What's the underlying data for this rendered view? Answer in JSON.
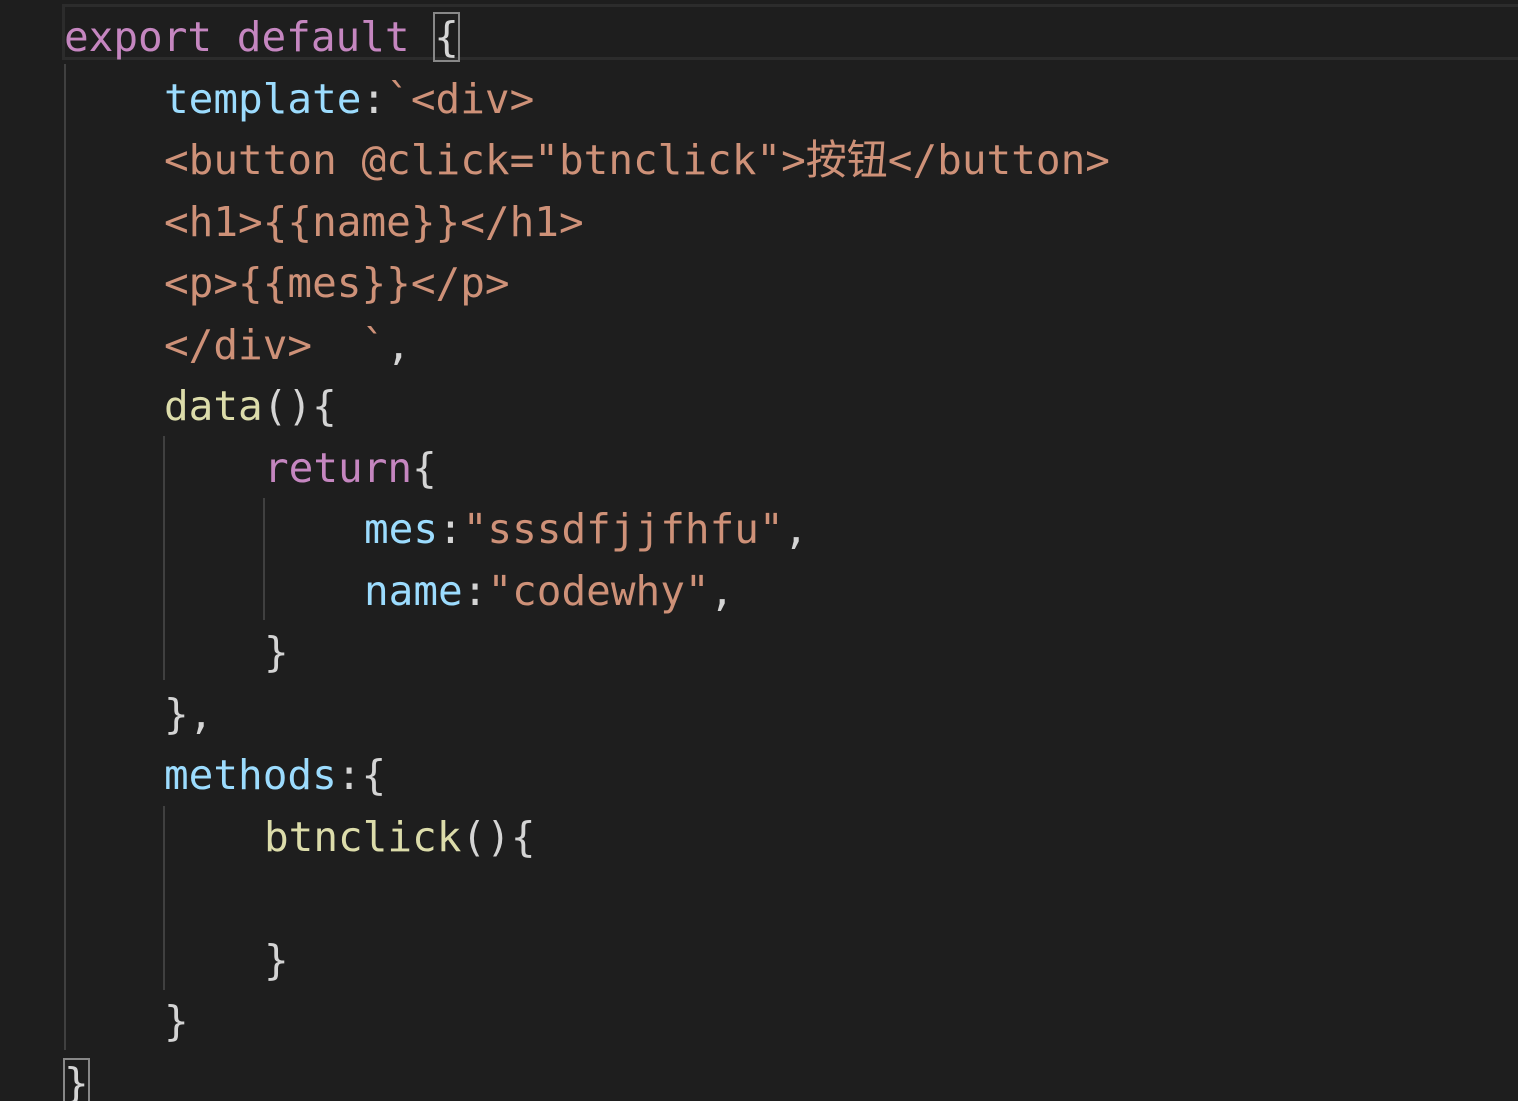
{
  "editor": {
    "colors": {
      "background": "#1e1e1e",
      "keyword": "#c586c0",
      "property": "#9cdcfe",
      "string": "#ce9178",
      "function": "#dcdcaa",
      "punctuation": "#d4d4d4",
      "bracket_highlight": "#888888"
    },
    "lines": [
      {
        "name": "line-export",
        "indent": 0,
        "tokens": [
          {
            "t": "export default ",
            "c": "keyword"
          },
          {
            "t": "{",
            "c": "punctuation",
            "highlight": true
          }
        ]
      },
      {
        "name": "line-template",
        "indent": 1,
        "tokens": [
          {
            "t": "template",
            "c": "property"
          },
          {
            "t": ":",
            "c": "punctuation"
          },
          {
            "t": "`<div>",
            "c": "string"
          }
        ]
      },
      {
        "name": "line-button",
        "indent": 1,
        "tokens": [
          {
            "t": "<button @click=\"btnclick\">按钮</button>",
            "c": "string"
          }
        ]
      },
      {
        "name": "line-h1",
        "indent": 1,
        "tokens": [
          {
            "t": "<h1>{{name}}</h1>",
            "c": "string"
          }
        ]
      },
      {
        "name": "line-p",
        "indent": 1,
        "tokens": [
          {
            "t": "<p>{{mes}}</p>",
            "c": "string"
          }
        ]
      },
      {
        "name": "line-div-close",
        "indent": 1,
        "tokens": [
          {
            "t": "</div>  `",
            "c": "string"
          },
          {
            "t": ",",
            "c": "punctuation"
          }
        ]
      },
      {
        "name": "line-data",
        "indent": 1,
        "tokens": [
          {
            "t": "data",
            "c": "function"
          },
          {
            "t": "(){",
            "c": "punctuation"
          }
        ]
      },
      {
        "name": "line-return",
        "indent": 2,
        "tokens": [
          {
            "t": "return",
            "c": "keyword"
          },
          {
            "t": "{",
            "c": "punctuation"
          }
        ]
      },
      {
        "name": "line-mes",
        "indent": 3,
        "tokens": [
          {
            "t": "mes",
            "c": "property"
          },
          {
            "t": ":",
            "c": "punctuation"
          },
          {
            "t": "\"sssdfjjfhfu\"",
            "c": "string"
          },
          {
            "t": ",",
            "c": "punctuation"
          }
        ]
      },
      {
        "name": "line-name",
        "indent": 3,
        "tokens": [
          {
            "t": "name",
            "c": "property"
          },
          {
            "t": ":",
            "c": "punctuation"
          },
          {
            "t": "\"codewhy\"",
            "c": "string"
          },
          {
            "t": ",",
            "c": "punctuation"
          }
        ]
      },
      {
        "name": "line-return-close",
        "indent": 2,
        "tokens": [
          {
            "t": "}",
            "c": "punctuation"
          }
        ]
      },
      {
        "name": "line-data-close",
        "indent": 1,
        "tokens": [
          {
            "t": "},",
            "c": "punctuation"
          }
        ]
      },
      {
        "name": "line-methods",
        "indent": 1,
        "tokens": [
          {
            "t": "methods",
            "c": "property"
          },
          {
            "t": ":{",
            "c": "punctuation"
          }
        ]
      },
      {
        "name": "line-btnclick",
        "indent": 2,
        "tokens": [
          {
            "t": "btnclick",
            "c": "function"
          },
          {
            "t": "(){",
            "c": "punctuation"
          }
        ]
      },
      {
        "name": "line-empty",
        "indent": 0,
        "tokens": []
      },
      {
        "name": "line-btnclick-close",
        "indent": 2,
        "tokens": [
          {
            "t": "}",
            "c": "punctuation"
          }
        ]
      },
      {
        "name": "line-methods-close",
        "indent": 1,
        "tokens": [
          {
            "t": "}",
            "c": "punctuation"
          }
        ]
      },
      {
        "name": "line-export-close",
        "indent": 0,
        "tokens": [
          {
            "t": "}",
            "c": "punctuation",
            "highlight": true
          }
        ]
      }
    ]
  }
}
